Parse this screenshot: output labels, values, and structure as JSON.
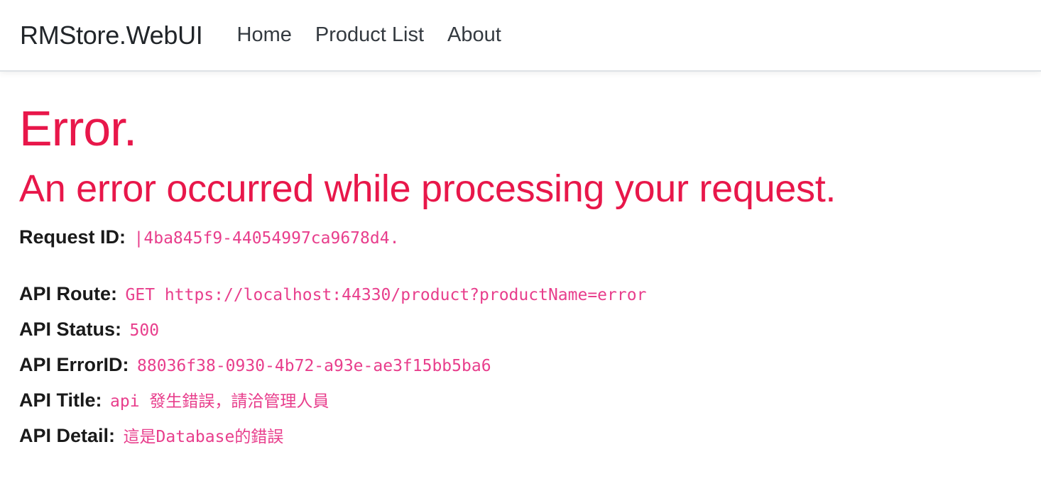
{
  "navbar": {
    "brand": "RMStore.WebUI",
    "links": [
      {
        "label": "Home"
      },
      {
        "label": "Product List"
      },
      {
        "label": "About"
      }
    ]
  },
  "main": {
    "title": "Error.",
    "subtitle": "An error occurred while processing your request.",
    "request": {
      "label": "Request ID:",
      "value": "|4ba845f9-44054997ca9678d4."
    },
    "api": [
      {
        "label": "API Route:",
        "value": "GET https://localhost:44330/product?productName=error"
      },
      {
        "label": "API Status:",
        "value": "500"
      },
      {
        "label": "API ErrorID:",
        "value": "88036f38-0930-4b72-a93e-ae3f15bb5ba6"
      },
      {
        "label": "API Title:",
        "value": "api 發生錯誤，請洽管理人員"
      },
      {
        "label": "API Detail:",
        "value": "這是Database的錯誤"
      }
    ]
  },
  "colors": {
    "error_heading": "#e8174a",
    "code_text": "#e83e8c"
  }
}
